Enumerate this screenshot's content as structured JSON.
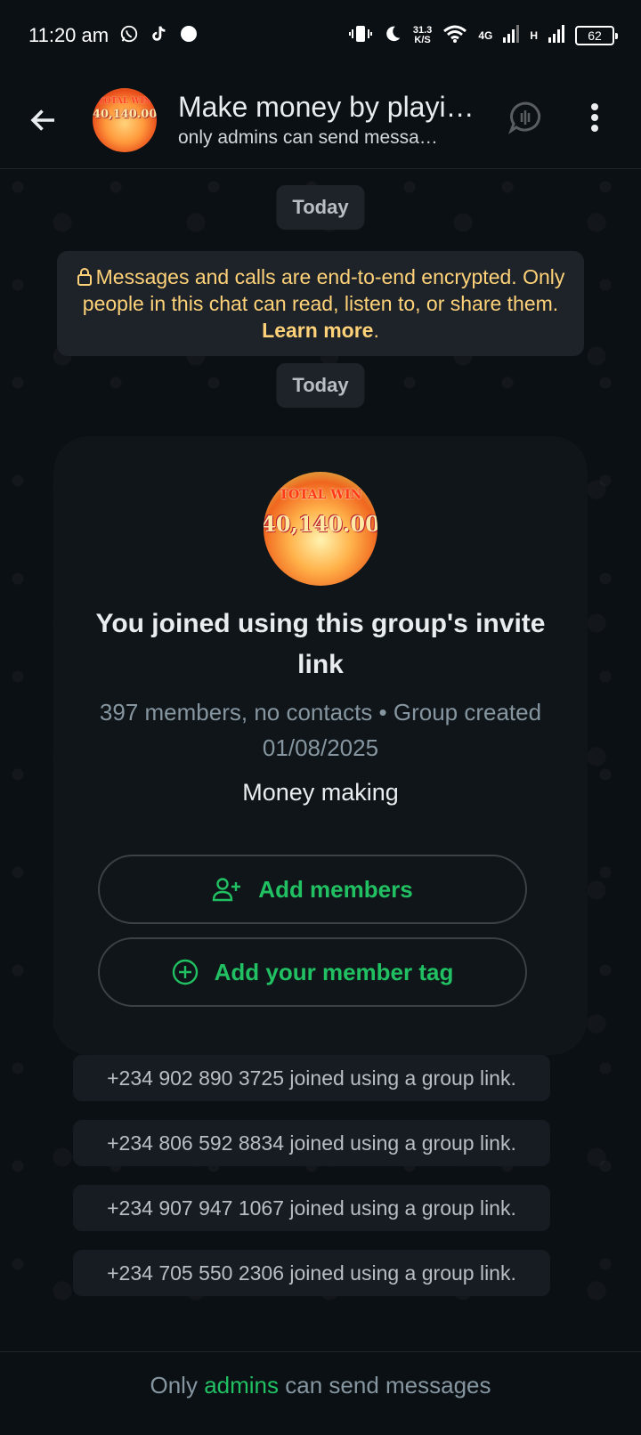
{
  "status_bar": {
    "time": "11:20 am",
    "net_speed_value": "31.3",
    "net_speed_unit": "K/S",
    "network_4g": "4G",
    "network_h": "H",
    "battery": "62"
  },
  "header": {
    "title": "Make money by playi…",
    "subtitle": "only admins can send messa…",
    "avatar_top_text": "TOTAL WIN",
    "avatar_amount": "40,140.00"
  },
  "chat": {
    "day_chip_1": "Today",
    "encryption": {
      "text": "Messages and calls are end-to-end encrypted. Only people in this chat can read, listen to, or share them.",
      "link": "Learn more",
      "trailing": "."
    },
    "day_chip_2": "Today",
    "group_card": {
      "avatar_top_text": "TOTAL WIN",
      "avatar_amount": "40,140.00",
      "title": "You joined using this group's invite link",
      "meta": "397 members, no contacts • Group created 01/08/2025",
      "description": "Money making",
      "add_members_label": "Add members",
      "add_tag_label": "Add your member tag"
    },
    "system_messages": [
      "+234 902 890 3725 joined using a group link.",
      "+234 806 592 8834 joined using a group link.",
      "+234 907 947 1067 joined using a group link.",
      "+234 705 550 2306 joined using a group link."
    ]
  },
  "footer": {
    "prefix": "Only",
    "link": "admins",
    "suffix": "can send messages"
  },
  "colors": {
    "background": "#0b1014",
    "accent_green": "#21c063",
    "encryption_yellow": "#ffd279",
    "chip_bg": "#1d2329"
  }
}
